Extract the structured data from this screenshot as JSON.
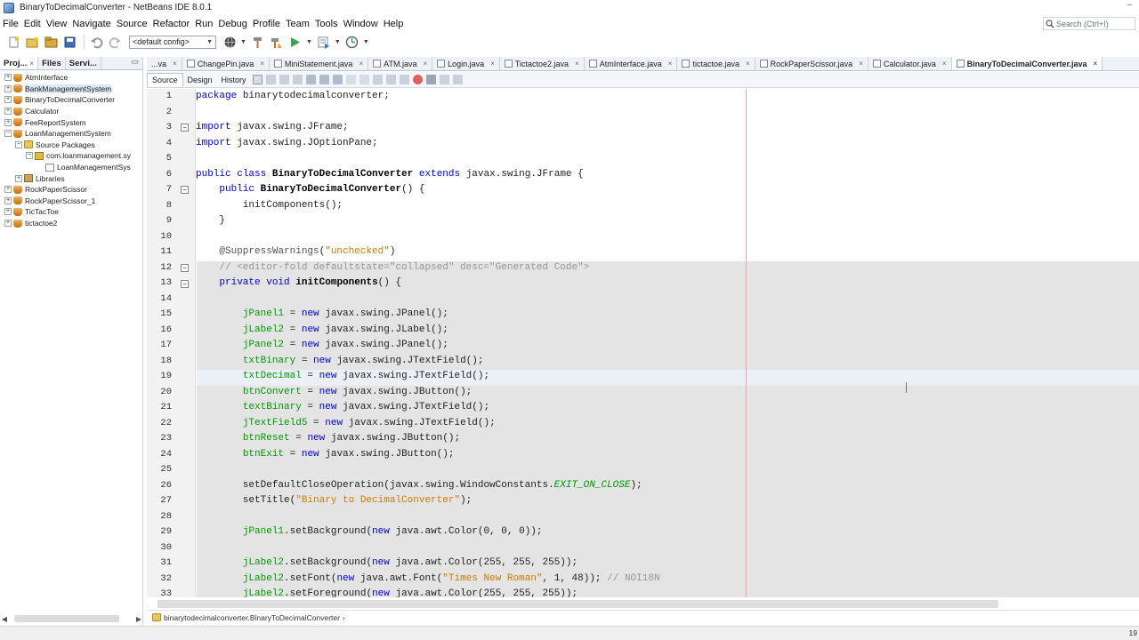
{
  "window": {
    "title": "BinaryToDecimalConverter - NetBeans IDE 8.0.1",
    "minimize_glyph": "–"
  },
  "menu": [
    "File",
    "Edit",
    "View",
    "Navigate",
    "Source",
    "Refactor",
    "Run",
    "Debug",
    "Profile",
    "Team",
    "Tools",
    "Window",
    "Help"
  ],
  "search": {
    "placeholder": "Search (Ctrl+I)"
  },
  "toolbar": {
    "config_value": "<default config>"
  },
  "left_panel": {
    "tabs": [
      {
        "label": "Proj...",
        "close": "×"
      },
      {
        "label": "Files",
        "close": ""
      },
      {
        "label": "Servi...",
        "close": ""
      }
    ],
    "minimize": "▭",
    "tree": [
      {
        "label": "AtmInterface",
        "indent": 0,
        "expander": "+",
        "icon": "coffee",
        "selected": false
      },
      {
        "label": "BankManagementSystem",
        "indent": 0,
        "expander": "+",
        "icon": "coffee",
        "selected": true
      },
      {
        "label": "BinaryToDecimalConverter",
        "indent": 0,
        "expander": "+",
        "icon": "coffee",
        "selected": false
      },
      {
        "label": "Calculator",
        "indent": 0,
        "expander": "+",
        "icon": "coffee",
        "selected": false
      },
      {
        "label": "FeeReportSystem",
        "indent": 0,
        "expander": "+",
        "icon": "coffee",
        "selected": false
      },
      {
        "label": "LoanManagementSystem",
        "indent": 0,
        "expander": "−",
        "icon": "coffee",
        "selected": false
      },
      {
        "label": "Source Packages",
        "indent": 1,
        "expander": "−",
        "icon": "folder",
        "selected": false
      },
      {
        "label": "com.loanmanagement.sy",
        "indent": 2,
        "expander": "−",
        "icon": "pkg",
        "selected": false
      },
      {
        "label": "LoanManagementSys",
        "indent": 3,
        "expander": "",
        "icon": "jfile",
        "selected": false
      },
      {
        "label": "Libraries",
        "indent": 1,
        "expander": "+",
        "icon": "libs",
        "selected": false
      },
      {
        "label": "RockPaperScissor",
        "indent": 0,
        "expander": "+",
        "icon": "coffee",
        "selected": false
      },
      {
        "label": "RockPaperScissor_1",
        "indent": 0,
        "expander": "+",
        "icon": "coffee",
        "selected": false
      },
      {
        "label": "TicTacToe",
        "indent": 0,
        "expander": "+",
        "icon": "coffee",
        "selected": false
      },
      {
        "label": "tictactoe2",
        "indent": 0,
        "expander": "+",
        "icon": "coffee",
        "selected": false
      }
    ]
  },
  "file_tabs": [
    {
      "label": "...va",
      "active": false
    },
    {
      "label": "ChangePin.java",
      "active": false
    },
    {
      "label": "MiniStatement.java",
      "active": false
    },
    {
      "label": "ATM.java",
      "active": false
    },
    {
      "label": "Login.java",
      "active": false
    },
    {
      "label": "Tictactoe2.java",
      "active": false
    },
    {
      "label": "AtmInterface.java",
      "active": false
    },
    {
      "label": "tictactoe.java",
      "active": false
    },
    {
      "label": "RockPaperScissor.java",
      "active": false
    },
    {
      "label": "Calculator.java",
      "active": false
    },
    {
      "label": "BinaryToDecimalConverter.java",
      "active": true
    }
  ],
  "editor_tabs": {
    "source": "Source",
    "design": "Design",
    "history": "History"
  },
  "code_lines": [
    {
      "n": "1",
      "html": "<span class='kw'>package</span> binarytodecimalconverter;"
    },
    {
      "n": "2",
      "html": ""
    },
    {
      "n": "3",
      "html": "<span class='kw'>import</span> javax.swing.JFrame;"
    },
    {
      "n": "4",
      "html": "<span class='kw'>import</span> javax.swing.JOptionPane;"
    },
    {
      "n": "5",
      "html": ""
    },
    {
      "n": "6",
      "html": "<span class='kw'>public</span> <span class='kw'>class</span> <span class='cls'>BinaryToDecimalConverter</span> <span class='kw'>extends</span> javax.swing.JFrame {"
    },
    {
      "n": "7",
      "html": "    <span class='kw'>public</span> <span class='cls'>BinaryToDecimalConverter</span>() {"
    },
    {
      "n": "8",
      "html": "        initComponents();"
    },
    {
      "n": "9",
      "html": "    }"
    },
    {
      "n": "10",
      "html": ""
    },
    {
      "n": "11",
      "html": "    <span class='ann'>@SuppressWarnings</span>(<span class='str'>\"unchecked\"</span>)"
    },
    {
      "n": "12",
      "html": "    <span class='cmt'>// &lt;editor-fold defaultstate=\"collapsed\" desc=\"Generated Code\"&gt;</span>"
    },
    {
      "n": "13",
      "html": "    <span class='kw'>private</span> <span class='kw'>void</span> <span class='cls'>initComponents</span>() {"
    },
    {
      "n": "14",
      "html": ""
    },
    {
      "n": "15",
      "html": "        <span class='fld'>jPanel1</span> = <span class='kw'>new</span> javax.swing.JPanel();"
    },
    {
      "n": "16",
      "html": "        <span class='fld'>jLabel2</span> = <span class='kw'>new</span> javax.swing.JLabel();"
    },
    {
      "n": "17",
      "html": "        <span class='fld'>jPanel2</span> = <span class='kw'>new</span> javax.swing.JPanel();"
    },
    {
      "n": "18",
      "html": "        <span class='fld'>txtBinary</span> = <span class='kw'>new</span> javax.swing.JTextField();"
    },
    {
      "n": "19",
      "html": "        <span class='fld'>txtDecimal</span> = <span class='kw'>new</span> javax.swing.JTextField();"
    },
    {
      "n": "20",
      "html": "        <span class='fld'>btnConvert</span> = <span class='kw'>new</span> javax.swing.JButton();"
    },
    {
      "n": "21",
      "html": "        <span class='fld'>textBinary</span> = <span class='kw'>new</span> javax.swing.JTextField();"
    },
    {
      "n": "22",
      "html": "        <span class='fld'>jTextField5</span> = <span class='kw'>new</span> javax.swing.JTextField();"
    },
    {
      "n": "23",
      "html": "        <span class='fld'>btnReset</span> = <span class='kw'>new</span> javax.swing.JButton();"
    },
    {
      "n": "24",
      "html": "        <span class='fld'>btnExit</span> = <span class='kw'>new</span> javax.swing.JButton();"
    },
    {
      "n": "25",
      "html": ""
    },
    {
      "n": "26",
      "html": "        setDefaultCloseOperation(javax.swing.WindowConstants.<span class='cnst'>EXIT_ON_CLOSE</span>);"
    },
    {
      "n": "27",
      "html": "        setTitle(<span class='str'>\"Binary to DecimalConverter\"</span>);"
    },
    {
      "n": "28",
      "html": ""
    },
    {
      "n": "29",
      "html": "        <span class='fld'>jPanel1</span>.setBackground(<span class='kw'>new</span> java.awt.Color(0, 0, 0));"
    },
    {
      "n": "30",
      "html": ""
    },
    {
      "n": "31",
      "html": "        <span class='fld'>jLabel2</span>.setBackground(<span class='kw'>new</span> java.awt.Color(255, 255, 255));"
    },
    {
      "n": "32",
      "html": "        <span class='fld'>jLabel2</span>.setFont(<span class='kw'>new</span> java.awt.Font(<span class='str'>\"Times New Roman\"</span>, 1, 48)); <span class='cmt'>// NOI18N</span>"
    },
    {
      "n": "33",
      "html": "        <span class='fld'>jLabel2</span>.setForeground(<span class='kw'>new</span> java.awt.Color(255, 255, 255));"
    }
  ],
  "breadcrumb": {
    "path": "binarytodecimalconverter.BinaryToDecimalConverter",
    "chevron": "›"
  },
  "status": {
    "caret_position": "19"
  },
  "colors": {
    "keyword": "#0000e6",
    "field": "#009900",
    "string": "#ce7b00",
    "comment": "#969696",
    "fold_shade": "#e4e4e4",
    "margin_line": "#e7a7a7"
  }
}
